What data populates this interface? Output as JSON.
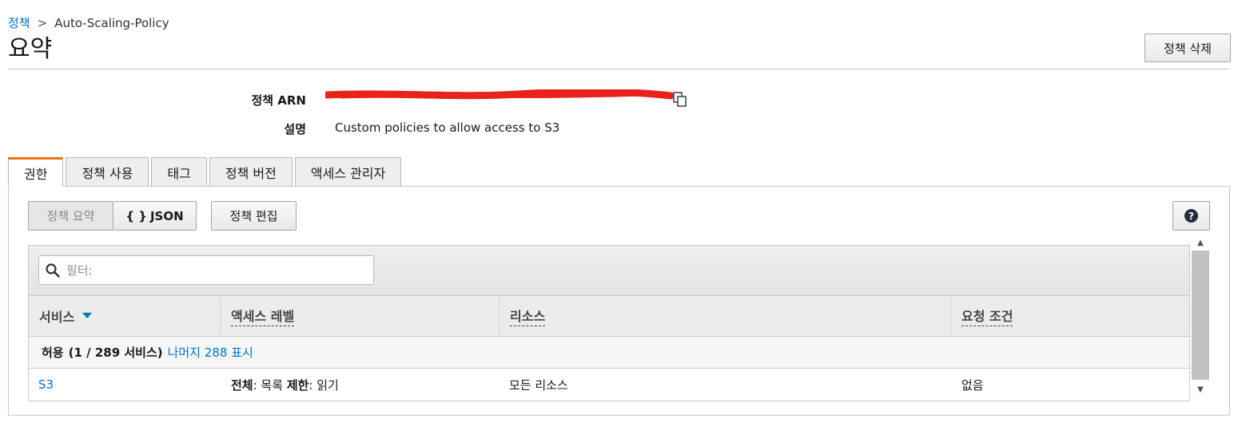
{
  "breadcrumb": {
    "parent": "정책",
    "separator": ">",
    "current": "Auto-Scaling-Policy"
  },
  "page": {
    "title": "요약",
    "delete_button": "정책 삭제"
  },
  "meta": {
    "arn_label": "정책 ARN",
    "desc_label": "설명",
    "desc_value": "Custom policies to allow access to S3"
  },
  "tabs": [
    "권한",
    "정책 사용",
    "태그",
    "정책 버전",
    "액세스 관리자"
  ],
  "toolbar": {
    "summary": "정책 요약",
    "json_icon": "{ }",
    "json": "JSON",
    "edit": "정책 편집",
    "help_icon": "?"
  },
  "filter": {
    "placeholder": "필터:"
  },
  "columns": [
    "서비스",
    "액세스 레벨",
    "리소스",
    "요청 조건"
  ],
  "group": {
    "label": "허용",
    "count": "(1 / 289 서비스)",
    "link": "나머지 288 표시"
  },
  "rows": [
    {
      "service": "S3",
      "access_bold": "전체",
      "access_rest": ": 목록 ",
      "access_bold2": "제한",
      "access_rest2": ": 읽기",
      "resource": "모든 리소스",
      "condition": "없음"
    }
  ],
  "colors": {
    "link": "#0073bb",
    "active_tab": "#ec7211",
    "redaction": "#e8231c"
  }
}
